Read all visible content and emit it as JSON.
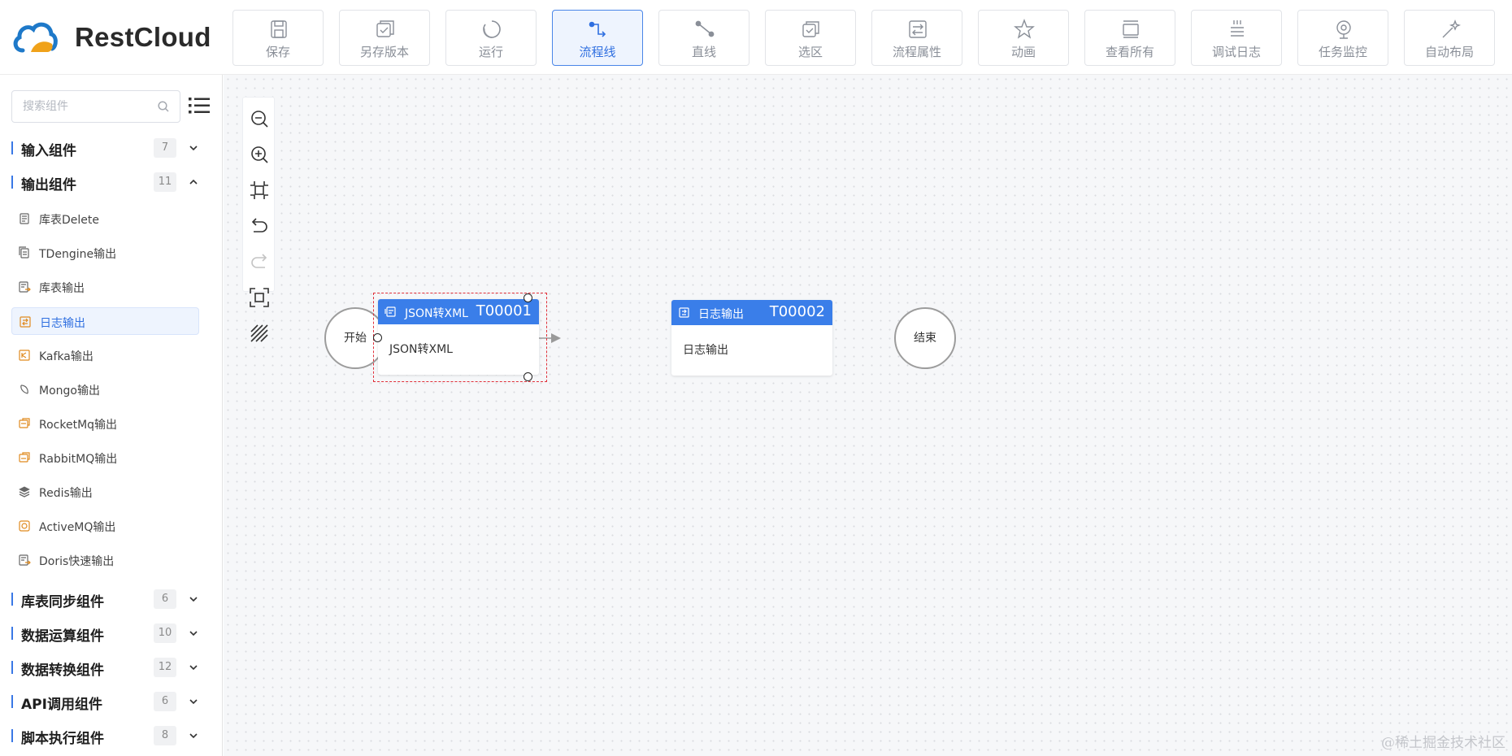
{
  "app": {
    "logo_text": "RestCloud",
    "logo_colors": {
      "cloud": "#1e79c9",
      "accent": "#f0a21a"
    }
  },
  "toolbar": {
    "active": "flowline",
    "buttons": [
      {
        "id": "save",
        "label": "保存",
        "icon": "save-icon"
      },
      {
        "id": "save-version",
        "label": "另存版本",
        "icon": "save-version-icon"
      },
      {
        "id": "run",
        "label": "运行",
        "icon": "run-icon"
      },
      {
        "id": "flowline",
        "label": "流程线",
        "icon": "flowline-icon"
      },
      {
        "id": "straight-line",
        "label": "直线",
        "icon": "straight-line-icon"
      },
      {
        "id": "select-area",
        "label": "选区",
        "icon": "select-area-icon"
      },
      {
        "id": "flow-props",
        "label": "流程属性",
        "icon": "flow-props-icon"
      },
      {
        "id": "animation",
        "label": "动画",
        "icon": "animation-icon"
      },
      {
        "id": "view-all",
        "label": "查看所有",
        "icon": "view-all-icon"
      },
      {
        "id": "debug-log",
        "label": "调试日志",
        "icon": "debug-log-icon"
      },
      {
        "id": "task-monitor",
        "label": "任务监控",
        "icon": "task-monitor-icon"
      },
      {
        "id": "auto-layout",
        "label": "自动布局",
        "icon": "auto-layout-icon"
      }
    ]
  },
  "sidebar": {
    "search_placeholder": "搜索组件",
    "groups_top": [
      {
        "title": "输入组件",
        "count": "7",
        "expanded": false
      },
      {
        "title": "输出组件",
        "count": "11",
        "expanded": true
      }
    ],
    "output_items": [
      {
        "label": "库表Delete",
        "icon": "table-delete-icon"
      },
      {
        "label": "TDengine输出",
        "icon": "tdengine-icon"
      },
      {
        "label": "库表输出",
        "icon": "table-output-icon"
      },
      {
        "label": "日志输出",
        "icon": "log-output-icon",
        "selected": true
      },
      {
        "label": "Kafka输出",
        "icon": "kafka-icon"
      },
      {
        "label": "Mongo输出",
        "icon": "mongo-icon"
      },
      {
        "label": "RocketMq输出",
        "icon": "rocketmq-icon"
      },
      {
        "label": "RabbitMQ输出",
        "icon": "rabbitmq-icon"
      },
      {
        "label": "Redis输出",
        "icon": "redis-icon"
      },
      {
        "label": "ActiveMQ输出",
        "icon": "activemq-icon"
      },
      {
        "label": "Doris快速输出",
        "icon": "doris-icon"
      }
    ],
    "groups_bottom": [
      {
        "title": "库表同步组件",
        "count": "6"
      },
      {
        "title": "数据运算组件",
        "count": "10"
      },
      {
        "title": "数据转换组件",
        "count": "12"
      },
      {
        "title": "API调用组件",
        "count": "6"
      },
      {
        "title": "脚本执行组件",
        "count": "8"
      }
    ]
  },
  "canvas": {
    "zoom_tools": [
      "zoom-out-icon",
      "zoom-in-icon",
      "fit-view-icon",
      "undo-icon",
      "redo-icon",
      "actual-size-icon",
      "grid-toggle-icon"
    ],
    "start_label": "开始",
    "end_label": "结束",
    "nodes": [
      {
        "name": "JSON转XML",
        "id": "T00001",
        "body": "JSON转XML",
        "selected": true
      },
      {
        "name": "日志输出",
        "id": "T00002",
        "body": "日志输出",
        "selected": false
      }
    ],
    "colors": {
      "node_header": "#3a7ee9",
      "selection": "#e0303a",
      "edge": "#9a9a9a"
    }
  },
  "watermark": "@稀土掘金技术社区"
}
